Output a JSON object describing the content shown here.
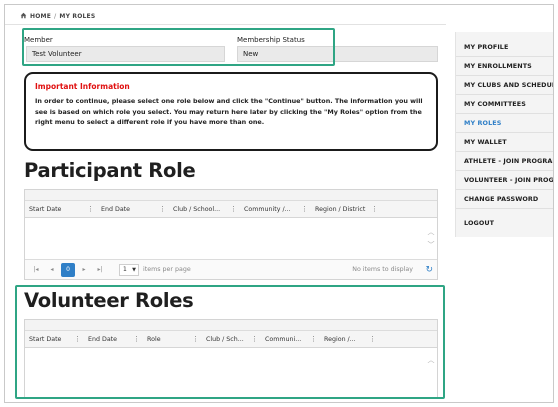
{
  "breadcrumb": {
    "home_icon": "home-icon",
    "home": "HOME",
    "separator": "/",
    "current": "MY ROLES"
  },
  "member": {
    "label": "Member",
    "value": "Test Volunteer"
  },
  "membership": {
    "label": "Membership Status",
    "value": "New"
  },
  "info": {
    "title": "Important Information",
    "text": "In order to continue, please select one role below and click the \"Continue\" button. The information you will see is based on which role you select. You may return here later by clicking the \"My Roles\" option from the right menu to select a different role if you have more than one."
  },
  "participant": {
    "title": "Participant Role",
    "columns": [
      "Start Date",
      "End Date",
      "Club / School...",
      "Community /...",
      "Region / District"
    ],
    "pager": {
      "first_icon": "first-page-icon",
      "prev_icon": "prev-page-icon",
      "page": "0",
      "next_icon": "next-page-icon",
      "last_icon": "last-page-icon",
      "per_page": "1",
      "per_page_label": "items per page",
      "info": "No items to display"
    }
  },
  "volunteer": {
    "title": "Volunteer Roles",
    "columns": [
      "Start Date",
      "End Date",
      "Role",
      "Club / Sch...",
      "Communi...",
      "Region /..."
    ]
  },
  "sidebar": {
    "items": [
      {
        "label": "MY PROFILE"
      },
      {
        "label": "MY ENROLLMENTS"
      },
      {
        "label": "MY CLUBS AND SCHEDULE"
      },
      {
        "label": "MY COMMITTEES"
      },
      {
        "label": "MY ROLES",
        "active": true
      },
      {
        "label": "MY WALLET"
      },
      {
        "label": "ATHLETE - JOIN PROGRAM"
      },
      {
        "label": "VOLUNTEER - JOIN PROGRAM"
      },
      {
        "label": "CHANGE PASSWORD"
      },
      {
        "label": "LOGOUT"
      }
    ]
  },
  "colors": {
    "accent": "#2f7fc7",
    "highlight": "#2fa584",
    "alert": "#e01010"
  }
}
